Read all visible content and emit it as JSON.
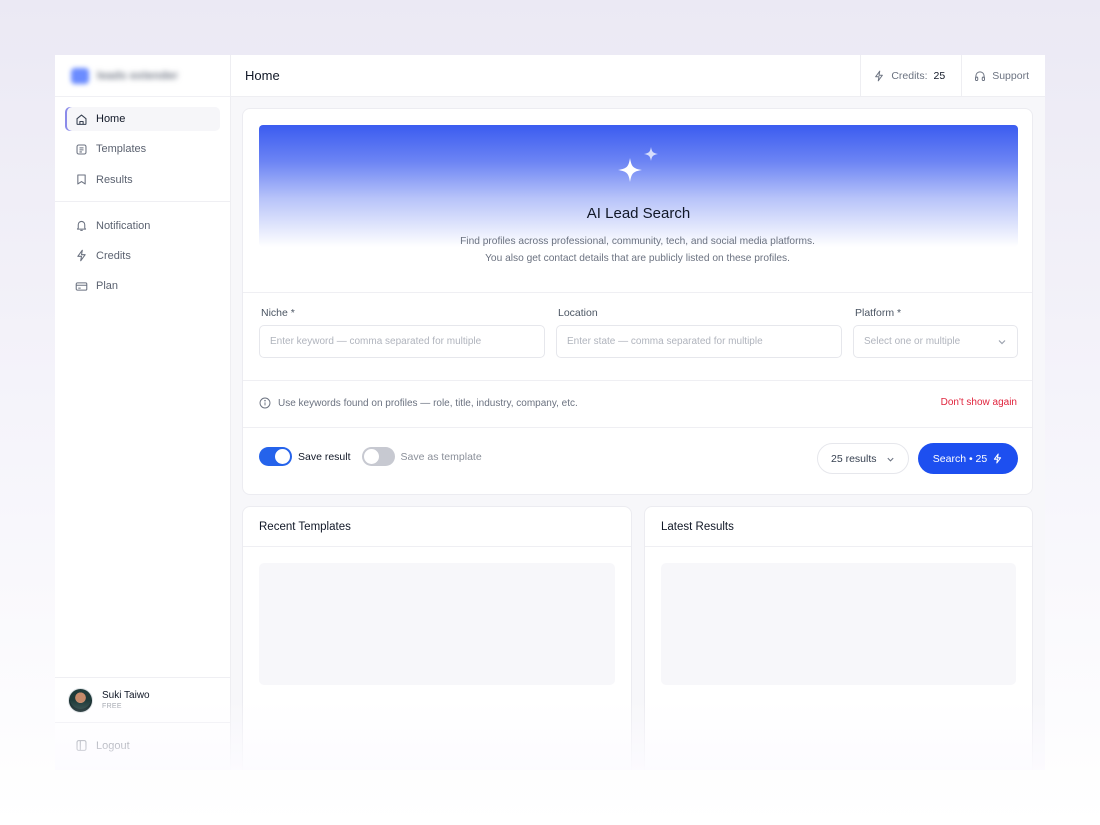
{
  "brand": {
    "name": "leads extender"
  },
  "sidebar": {
    "items": [
      {
        "label": "Home",
        "icon": "home-icon",
        "active": true
      },
      {
        "label": "Templates",
        "icon": "document-icon",
        "active": false
      },
      {
        "label": "Results",
        "icon": "bookmark-icon",
        "active": false
      }
    ],
    "items2": [
      {
        "label": "Notification",
        "icon": "bell-icon"
      },
      {
        "label": "Credits",
        "icon": "lightning-icon"
      },
      {
        "label": "Plan",
        "icon": "credit-card-icon"
      }
    ],
    "user": {
      "name": "Suki Taiwo",
      "plan": "FREE"
    },
    "logout_label": "Logout"
  },
  "header": {
    "title": "Home",
    "credits_label": "Credits:",
    "credits_value": "25",
    "support_label": "Support"
  },
  "hero": {
    "title": "AI Lead Search",
    "desc_line1": "Find profiles across professional, community, tech, and social media platforms.",
    "desc_line2": "You also get contact details that are publicly listed on these profiles."
  },
  "form": {
    "niche_label": "Niche *",
    "niche_placeholder": "Enter keyword — comma separated for multiple",
    "location_label": "Location",
    "location_placeholder": "Enter state — comma separated for multiple",
    "platform_label": "Platform *",
    "platform_placeholder": "Select one or multiple"
  },
  "tip": {
    "text": "Use keywords found on profiles — role, title, industry, company, etc.",
    "dismiss": "Don't show again"
  },
  "options": {
    "save_result_label": "Save result",
    "save_result_on": true,
    "save_template_label": "Save as template",
    "save_template_on": false,
    "results_count": "25 results",
    "search_label": "Search • 25"
  },
  "panels": {
    "recent_templates": "Recent Templates",
    "latest_results": "Latest Results"
  },
  "colors": {
    "accent": "#1d4ff0",
    "danger": "#e0243d"
  }
}
